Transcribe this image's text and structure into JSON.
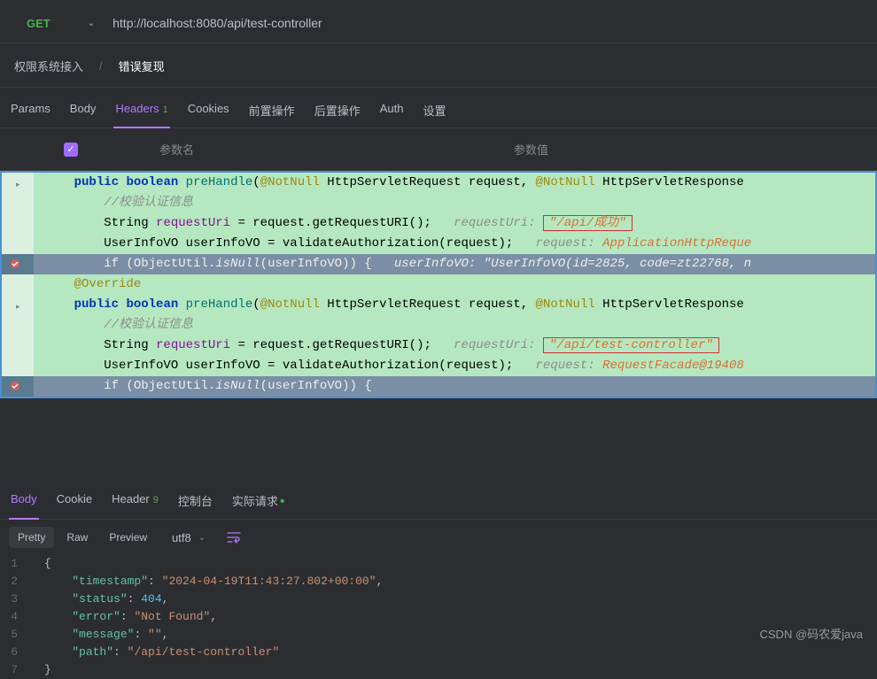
{
  "topBar": {
    "method": "GET",
    "url": "http://localhost:8080/api/test-controller"
  },
  "breadcrumb": {
    "items": [
      "权限系统接入",
      "错误复现"
    ],
    "separator": "/"
  },
  "requestTabs": {
    "items": [
      {
        "label": "Params",
        "active": false
      },
      {
        "label": "Body",
        "active": false
      },
      {
        "label": "Headers",
        "active": true,
        "count": "1"
      },
      {
        "label": "Cookies",
        "active": false
      },
      {
        "label": "前置操作",
        "active": false
      },
      {
        "label": "后置操作",
        "active": false
      },
      {
        "label": "Auth",
        "active": false
      },
      {
        "label": "设置",
        "active": false
      }
    ]
  },
  "tableHeader": {
    "paramName": "参数名",
    "paramValue": "参数值"
  },
  "code": {
    "block1": {
      "line1": {
        "pre": "    ",
        "kw1": "public",
        "sp1": " ",
        "kw2": "boolean",
        "sp2": " ",
        "fn": "preHandle",
        "args1": "(",
        "anno1": "@NotNull",
        "args2": " HttpServletRequest request, ",
        "anno2": "@NotNull",
        "args3": " HttpServletResponse"
      },
      "line2": {
        "pre": "        ",
        "comment": "//校验认证信息"
      },
      "line3": {
        "pre": "        String ",
        "var": "requestUri",
        "mid": " = request.getRequestURI();   ",
        "hint": "requestUri: ",
        "boxed": "\"/api/成功\""
      },
      "line4": {
        "pre": "        UserInfoVO userInfoVO = validateAuthorization(request);   ",
        "hint": "request: ",
        "val": "ApplicationHttpReque"
      },
      "line5": {
        "hl": true,
        "pre": "        ",
        "kw": "if",
        "mid": " (ObjectUtil.",
        "ital": "isNull",
        "rest": "(userInfoVO)) {   ",
        "hint": "userInfoVO: \"UserInfoVO(id=2825, code=zt22768, n"
      }
    },
    "block2": {
      "override": "@Override",
      "line1": {
        "pre": "    ",
        "kw1": "public",
        "sp1": " ",
        "kw2": "boolean",
        "sp2": " ",
        "fn": "preHandle",
        "args1": "(",
        "anno1": "@NotNull",
        "args2": " HttpServletRequest request, ",
        "anno2": "@NotNull",
        "args3": " HttpServletResponse"
      },
      "line2": {
        "pre": "        ",
        "comment": "//校验认证信息"
      },
      "line3": {
        "pre": "        String ",
        "var": "requestUri",
        "mid": " = request.getRequestURI();   ",
        "hint": "requestUri: ",
        "boxed": "\"/api/test-controller\""
      },
      "line4": {
        "pre": "        UserInfoVO userInfoVO = validateAuthorization(request);   ",
        "hint": "request: ",
        "val": "RequestFacade@19408"
      },
      "line5": {
        "hl": true,
        "pre": "        ",
        "kw": "if",
        "mid": " (ObjectUtil.",
        "ital": "isNull",
        "rest": "(userInfoVO)) {"
      }
    }
  },
  "responseTabs": {
    "items": [
      {
        "label": "Body",
        "active": true
      },
      {
        "label": "Cookie",
        "active": false
      },
      {
        "label": "Header",
        "active": false,
        "count": "9"
      },
      {
        "label": "控制台",
        "active": false
      },
      {
        "label": "实际请求",
        "active": false,
        "dot": true
      }
    ]
  },
  "viewControls": {
    "pretty": "Pretty",
    "raw": "Raw",
    "preview": "Preview",
    "encoding": "utf8"
  },
  "jsonResponse": {
    "lines": [
      "1",
      "2",
      "3",
      "4",
      "5",
      "6",
      "7"
    ],
    "content": [
      {
        "type": "punct",
        "text": "{"
      },
      {
        "indent": 1,
        "key": "\"timestamp\"",
        "value": "\"2024-04-19T11:43:27.802+00:00\"",
        "valueType": "string",
        "comma": true
      },
      {
        "indent": 1,
        "key": "\"status\"",
        "value": "404",
        "valueType": "number",
        "comma": true
      },
      {
        "indent": 1,
        "key": "\"error\"",
        "value": "\"Not Found\"",
        "valueType": "string",
        "comma": true
      },
      {
        "indent": 1,
        "key": "\"message\"",
        "value": "\"\"",
        "valueType": "string",
        "comma": true
      },
      {
        "indent": 1,
        "key": "\"path\"",
        "value": "\"/api/test-controller\"",
        "valueType": "string",
        "comma": false
      },
      {
        "type": "punct",
        "text": "}"
      }
    ]
  },
  "watermark": "CSDN @码农爱java"
}
